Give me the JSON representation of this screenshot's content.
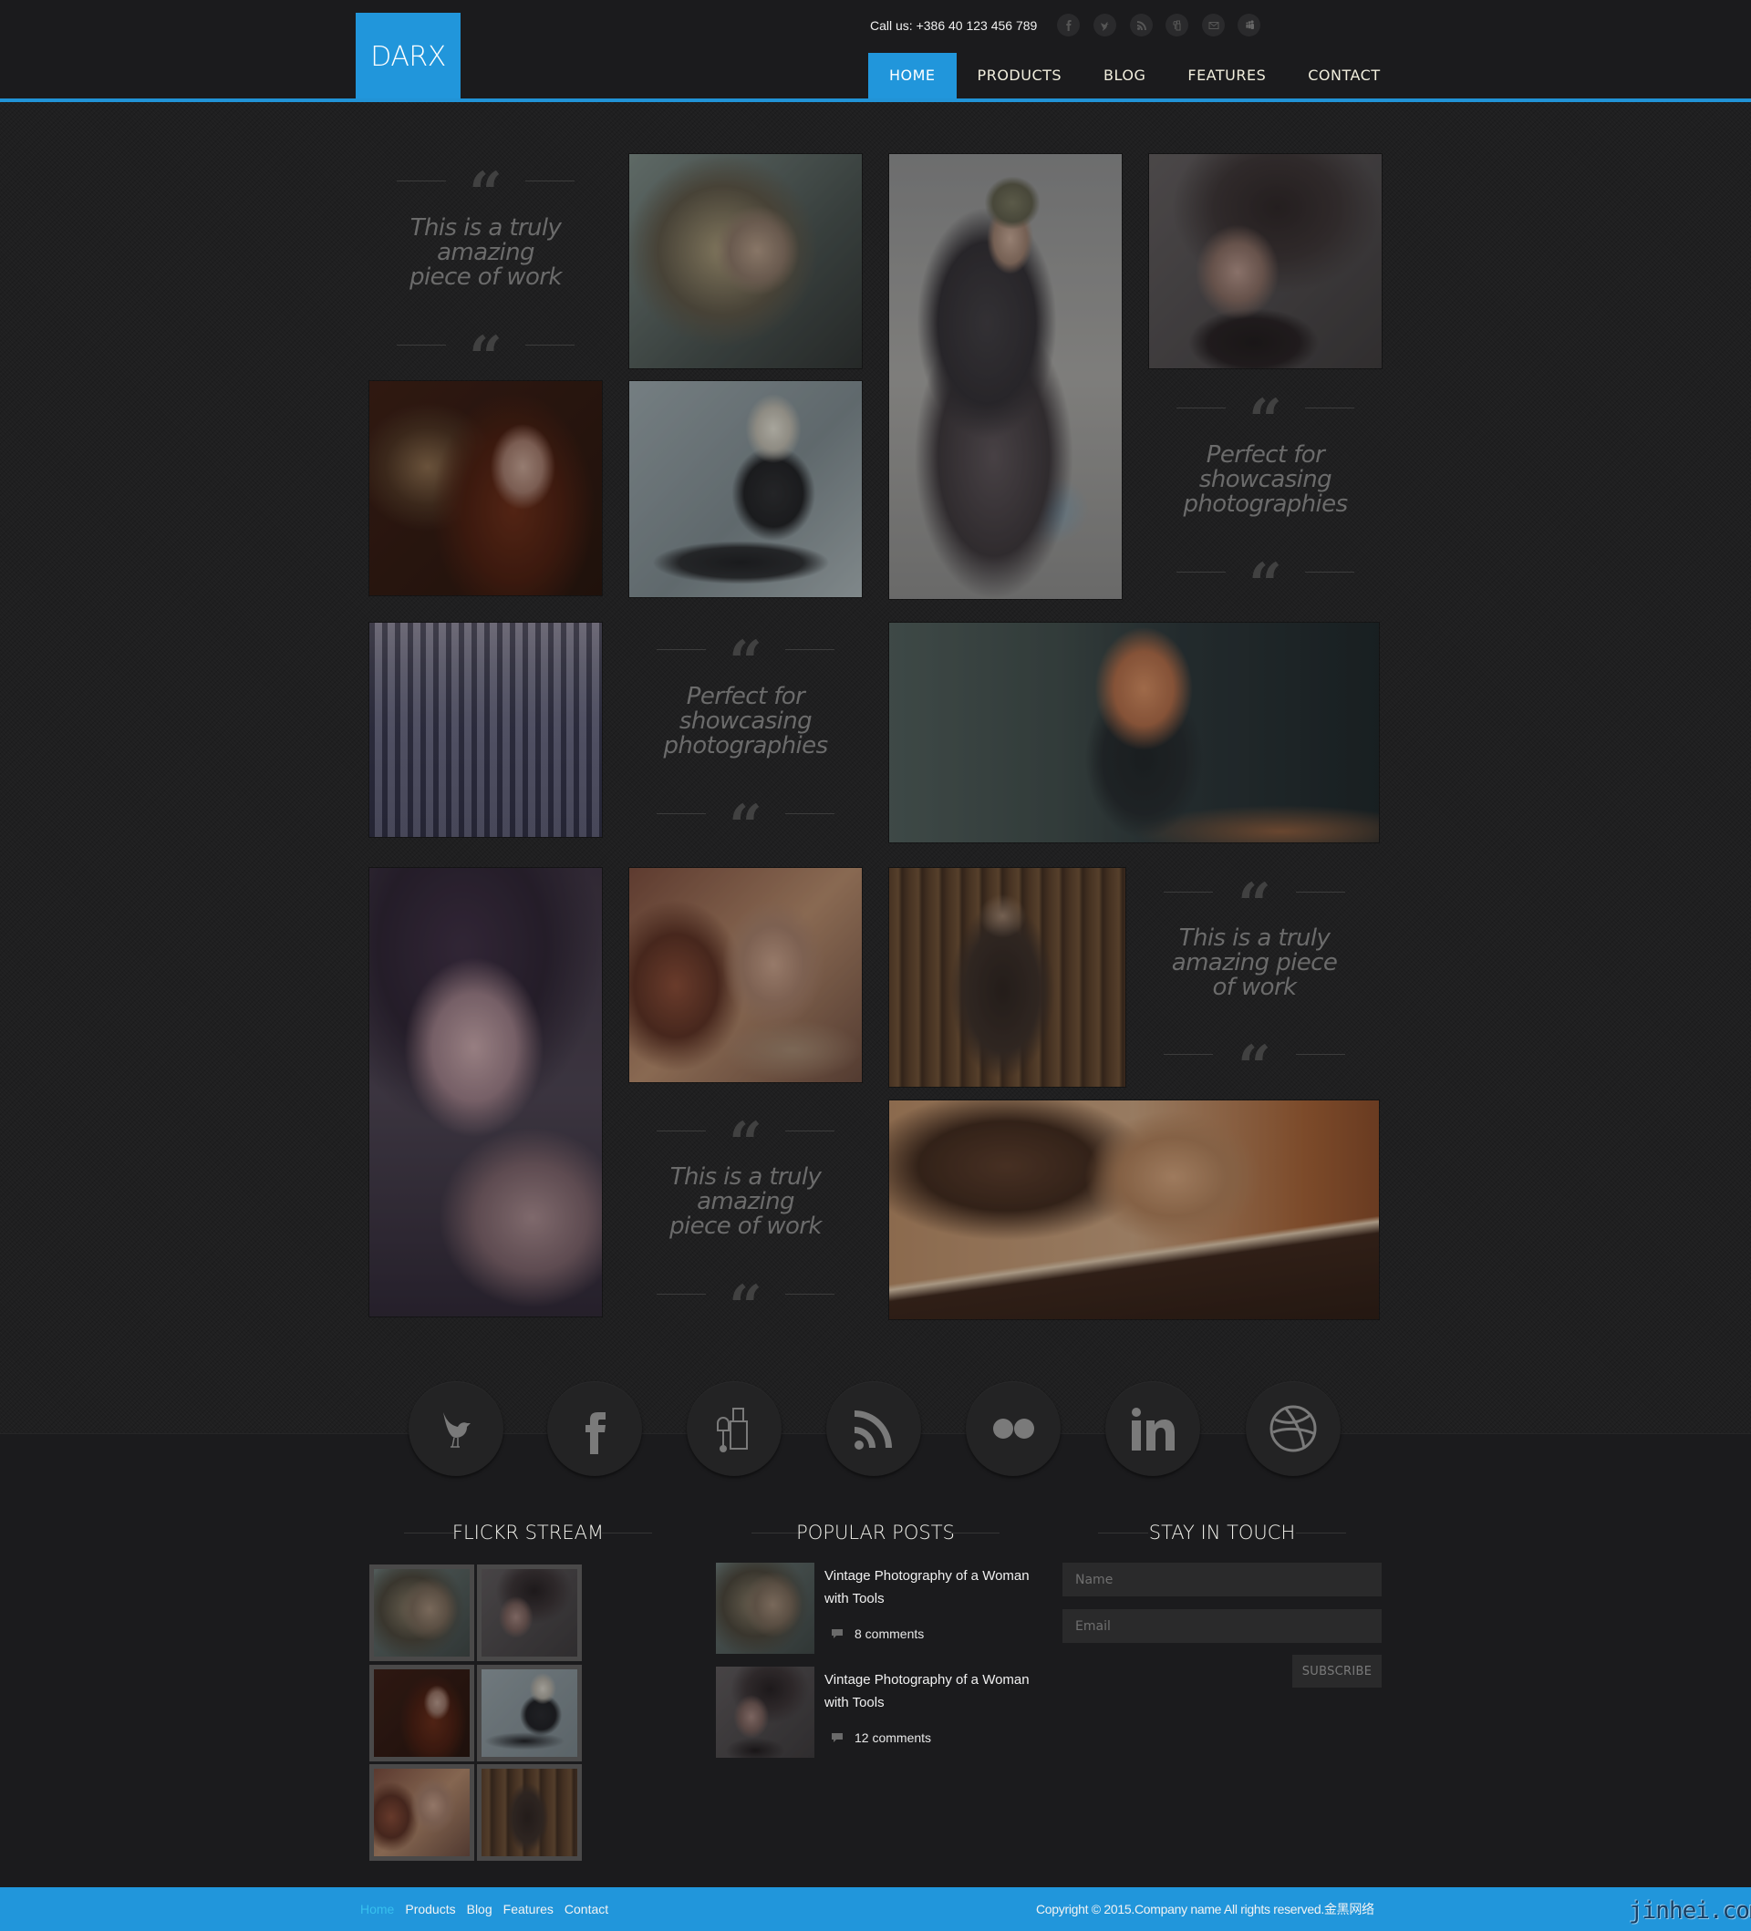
{
  "brand": {
    "logo_text": "DARX",
    "accent_color": "#2196db"
  },
  "header": {
    "call_us": "Call us: +386 40 123 456 789",
    "top_social": [
      {
        "name": "facebook-icon"
      },
      {
        "name": "twitter-icon"
      },
      {
        "name": "rss-icon"
      },
      {
        "name": "delicious-icon"
      },
      {
        "name": "email-icon"
      },
      {
        "name": "myspace-icon"
      }
    ],
    "nav": [
      {
        "label": "HOME",
        "active": true
      },
      {
        "label": "PRODUCTS",
        "active": false
      },
      {
        "label": "BLOG",
        "active": false
      },
      {
        "label": "FEATURES",
        "active": false
      },
      {
        "label": "CONTACT",
        "active": false
      }
    ]
  },
  "gallery": {
    "quotes": [
      {
        "text": "This is a truly amazing piece of work",
        "lines": [
          "This is a truly",
          "amazing",
          "piece of work"
        ]
      },
      {
        "text": "Perfect for showcasing photographies",
        "lines": [
          "Perfect for",
          "showcasing",
          "photographies"
        ]
      },
      {
        "text": "Perfect for showcasing photographies",
        "lines": [
          "Perfect for",
          "showcasing",
          "photographies"
        ]
      },
      {
        "text": "This is a truly amazing piece of work",
        "lines": [
          "This is a truly",
          "amazing piece",
          "of work"
        ]
      },
      {
        "text": "This is a truly amazing piece of work",
        "lines": [
          "This is a truly",
          "amazing",
          "piece of work"
        ]
      }
    ],
    "photos": [
      {
        "alt": "Portrait of woman with curly blonde hair"
      },
      {
        "alt": "Woman wearing cap sitting on floor"
      },
      {
        "alt": "Woman with flowing dark hair in black corset"
      },
      {
        "alt": "Woman with long red hair in warm light"
      },
      {
        "alt": "Platinum blonde woman posing on floor"
      },
      {
        "alt": "City skyline with skyscrapers"
      },
      {
        "alt": "Red-haired woman sitting on car hood"
      },
      {
        "alt": "Woman with curly hair and purple makeup"
      },
      {
        "alt": "Woman with jewelry and floral background"
      },
      {
        "alt": "Woman posing by rustic wooden wall"
      },
      {
        "alt": "Woman driving vintage car in rain"
      }
    ]
  },
  "social_row": [
    {
      "name": "twitter-bird-icon"
    },
    {
      "name": "facebook-icon"
    },
    {
      "name": "delicious-icon"
    },
    {
      "name": "rss-icon"
    },
    {
      "name": "flickr-icon"
    },
    {
      "name": "linkedin-icon"
    },
    {
      "name": "dribbble-icon"
    }
  ],
  "widgets": {
    "flickr": {
      "title": "FLICKR STREAM",
      "thumbs": [
        {
          "alt": "Curly blonde portrait"
        },
        {
          "alt": "Woman with flowing dark hair"
        },
        {
          "alt": "Woman with long red hair"
        },
        {
          "alt": "Platinum blonde posing"
        },
        {
          "alt": "Woman with jewelry"
        },
        {
          "alt": "Woman by wooden wall"
        }
      ]
    },
    "popular": {
      "title": "POPULAR POSTS",
      "posts": [
        {
          "title": "Vintage Photography of a Woman with Tools",
          "comments": "8 comments"
        },
        {
          "title": "Vintage Photography of a Woman with Tools",
          "comments": "12 comments"
        }
      ]
    },
    "stay_in_touch": {
      "title": "STAY IN TOUCH",
      "name_placeholder": "Name",
      "email_placeholder": "Email",
      "subscribe_label": "SUBSCRIBE"
    }
  },
  "footer": {
    "nav": [
      {
        "label": "Home",
        "active": true
      },
      {
        "label": "Products",
        "active": false
      },
      {
        "label": "Blog",
        "active": false
      },
      {
        "label": "Features",
        "active": false
      },
      {
        "label": "Contact",
        "active": false
      }
    ],
    "copyright": "Copyright © 2015.Company name All rights reserved.金黑网络",
    "watermark": "jinhei.com"
  }
}
